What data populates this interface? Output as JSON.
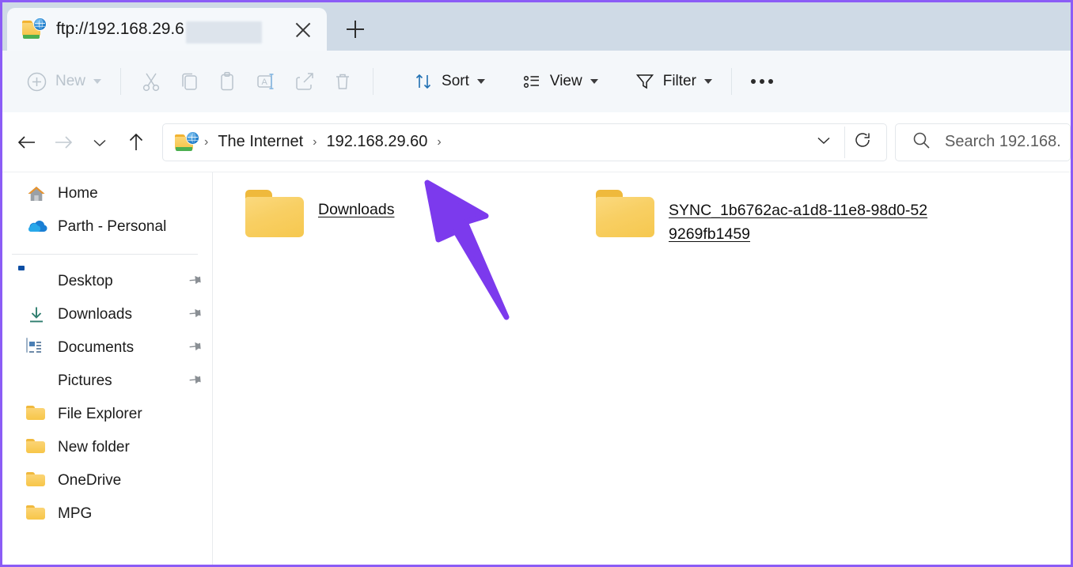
{
  "window": {
    "border_color": "#8b5cf6",
    "titlebar_bg": "#cfdae6"
  },
  "titlebar": {
    "tab": {
      "icon": "ftp-folder-globe-icon",
      "title": "ftp://192.168.29.6",
      "has_redaction": true,
      "close_label": "Close tab"
    },
    "new_tab_label": "New tab"
  },
  "toolbar": {
    "new_label": "New",
    "items": [
      {
        "name": "new-button",
        "label": "New",
        "icon": "plus-circle-icon",
        "disabled": true,
        "has_chevron": true
      },
      {
        "name": "cut-button",
        "label": "Cut",
        "icon": "scissors-icon",
        "disabled": true
      },
      {
        "name": "copy-button",
        "label": "Copy",
        "icon": "copy-icon",
        "disabled": true
      },
      {
        "name": "paste-button",
        "label": "Paste",
        "icon": "clipboard-icon",
        "disabled": true
      },
      {
        "name": "rename-button",
        "label": "Rename",
        "icon": "rename-icon",
        "disabled": true
      },
      {
        "name": "share-button",
        "label": "Share",
        "icon": "share-icon",
        "disabled": true
      },
      {
        "name": "delete-button",
        "label": "Delete",
        "icon": "trash-icon",
        "disabled": true
      }
    ],
    "sort_label": "Sort",
    "view_label": "View",
    "filter_label": "Filter",
    "overflow_label": "See more"
  },
  "address": {
    "back_label": "Back",
    "forward_label": "Forward",
    "recent_label": "Recent locations",
    "up_label": "Up to The Internet",
    "icon": "ftp-folder-globe-icon",
    "breadcrumbs": [
      "The Internet",
      "192.168.29.60"
    ],
    "separator": "›",
    "dropdown_label": "Previous locations",
    "refresh_label": "Refresh",
    "search": {
      "placeholder": "Search 192.168.",
      "value": "",
      "icon": "search-icon"
    }
  },
  "sidebar": {
    "groups": [
      {
        "items": [
          {
            "label": "Home",
            "icon": "home-icon",
            "pinned": false
          },
          {
            "label": "Parth - Personal",
            "icon": "onedrive-cloud-icon",
            "pinned": false
          }
        ]
      },
      {
        "items": [
          {
            "label": "Desktop",
            "icon": "desktop-icon",
            "pinned": true
          },
          {
            "label": "Downloads",
            "icon": "download-arrow-icon",
            "pinned": true
          },
          {
            "label": "Documents",
            "icon": "document-icon",
            "pinned": true
          },
          {
            "label": "Pictures",
            "icon": "picture-icon",
            "pinned": true
          },
          {
            "label": "File Explorer",
            "icon": "folder-icon",
            "pinned": false
          },
          {
            "label": "New folder",
            "icon": "folder-icon",
            "pinned": false
          },
          {
            "label": "OneDrive",
            "icon": "folder-icon",
            "pinned": false
          },
          {
            "label": "MPG",
            "icon": "folder-icon",
            "pinned": false
          }
        ]
      }
    ]
  },
  "files": [
    {
      "name": "Downloads",
      "icon": "folder-icon",
      "underlined": true
    },
    {
      "name": "SYNC_1b6762ac-a1d8-11e8-98d0-529269fb1459",
      "icon": "folder-icon",
      "underlined": true
    }
  ],
  "annotation": {
    "arrow_color": "#7c3aed",
    "points_to": "breadcrumb"
  }
}
